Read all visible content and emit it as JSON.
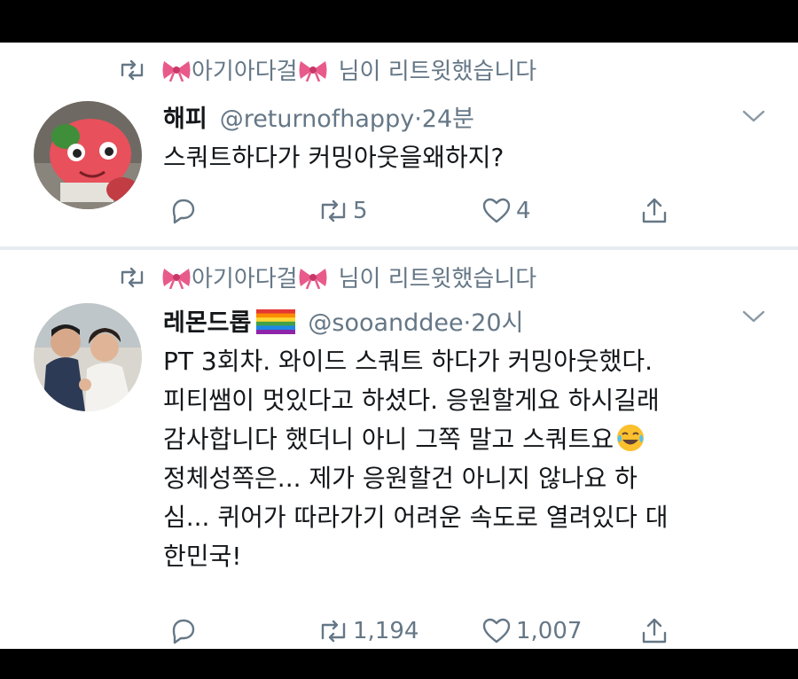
{
  "tweets": [
    {
      "retweet_header": {
        "name": "아기아다걸",
        "suffix": "님이 리트윗했습니다"
      },
      "author": {
        "name": "해피",
        "handle": "@returnofhappy",
        "dot": "·",
        "time": "24분"
      },
      "text_lines": [
        "스쿼트하다가 커밍아웃을왜하지?"
      ],
      "stats": {
        "retweets": "5",
        "likes": "4"
      },
      "avatar_icon": "pink-cartoon-character-avatar"
    },
    {
      "retweet_header": {
        "name": "아기아다걸",
        "suffix": "님이 리트윗했습니다"
      },
      "author": {
        "name": "레몬드롭",
        "handle": "@sooanddee",
        "dot": "·",
        "time": "20시"
      },
      "flag_icon": "rainbow-flag-icon",
      "text_lines": [
        "PT 3회차. 와이드 스쿼트 하다가 커밍아웃했다.",
        "피티쌤이 멋있다고 하셨다. 응원할게요 하시길래",
        "감사합니다 했더니 아니 그쪽 말고 스쿼트요",
        "정체성쪽은... 제가 응원할건 아니지 않나요 하",
        "심... 퀴어가 따라가기 어려운 속도로 열려있다 대",
        "한민국!"
      ],
      "emoji_icon": "tears-of-joy-emoji",
      "stats": {
        "retweets": "1,194",
        "likes": "1,007"
      },
      "avatar_icon": "wedding-couple-photo-avatar"
    }
  ],
  "icons": {
    "retweet": "retweet-icon",
    "bow": "pink-bow-icon",
    "reply": "reply-icon",
    "like": "heart-icon",
    "share": "share-icon",
    "more": "chevron-down-icon"
  },
  "colors": {
    "text_primary": "#14171a",
    "text_secondary": "#657786",
    "divider": "#e6ecf0",
    "bow": "#e85a8a"
  }
}
